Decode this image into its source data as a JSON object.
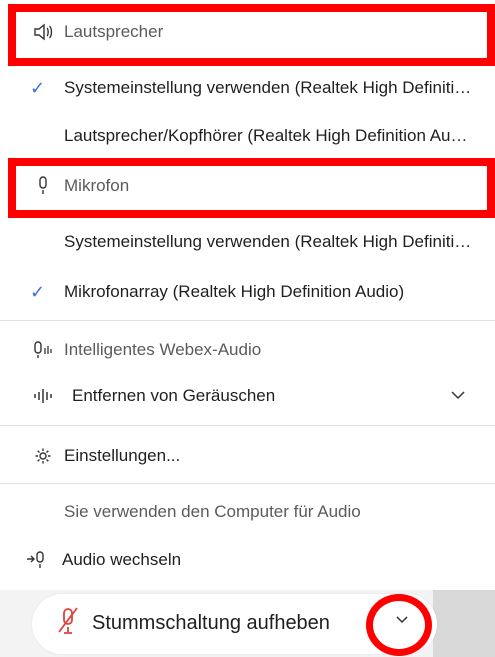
{
  "speaker": {
    "header": "Lautsprecher",
    "items": [
      {
        "label": "Systemeinstellung verwenden (Realtek High Definition Audio)",
        "checked": true
      },
      {
        "label": "Lautsprecher/Kopfhörer (Realtek High Definition Audio)",
        "checked": false
      }
    ]
  },
  "microphone": {
    "header": "Mikrofon",
    "items": [
      {
        "label": "Systemeinstellung verwenden (Realtek High Definition Audio)",
        "checked": false
      },
      {
        "label": "Mikrofonarray (Realtek High Definition Audio)",
        "checked": true
      }
    ]
  },
  "smart_audio": {
    "header": "Intelligentes Webex-Audio",
    "noise_label": "Entfernen von Geräuschen"
  },
  "settings_label": "Einstellungen...",
  "computer_audio_note": "Sie verwenden den Computer für Audio",
  "switch_audio_label": "Audio wechseln",
  "unmute_label": "Stummschaltung aufheben",
  "colors": {
    "highlight": "#ff0000",
    "check": "#3a6fd8",
    "mic_off": "#e0403a"
  },
  "icons": {
    "speaker": "speaker-icon",
    "microphone": "microphone-icon",
    "smart_audio": "smart-audio-icon",
    "noise": "noise-removal-icon",
    "settings": "gear-icon",
    "switch": "switch-audio-icon",
    "mic_muted": "microphone-muted-icon",
    "chevron": "chevron-down-icon"
  }
}
